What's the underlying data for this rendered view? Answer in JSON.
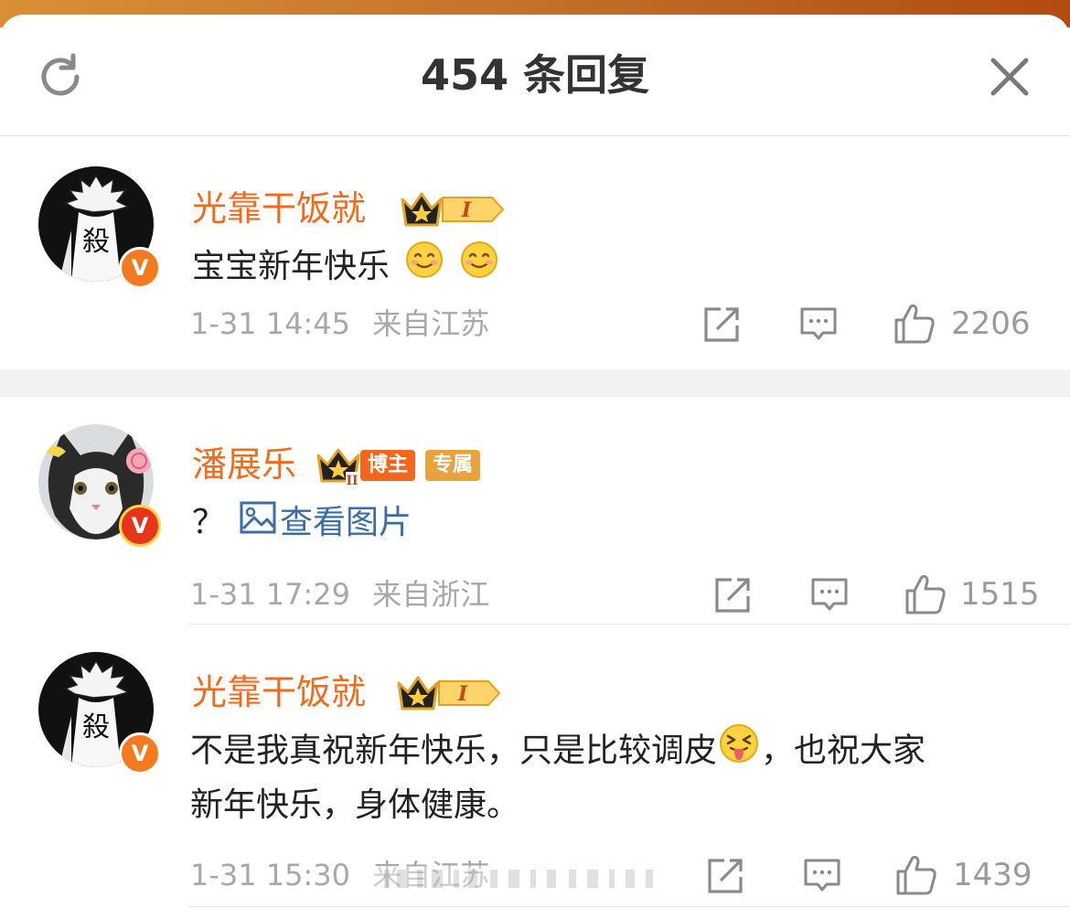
{
  "header": {
    "title": "454 条回复",
    "refresh_icon": "refresh-icon",
    "close_icon": "close-icon"
  },
  "colors": {
    "username": "#f26a1b",
    "link": "#3a6ea5",
    "meta": "#a8a8a8",
    "vbadge_orange": "#f47a20",
    "vbadge_red": "#e8341c"
  },
  "comments": [
    {
      "username": "光靠干饭就",
      "badge_level": "I",
      "text": "宝宝新年快乐",
      "emojis": [
        "smile-emoji",
        "smile-emoji"
      ],
      "time": "1-31 14:45",
      "location": "来自江苏",
      "likes": "2206"
    },
    {
      "username": "潘展乐",
      "badge_level": "II",
      "tags": [
        "博主",
        "专属"
      ],
      "text": "？",
      "image_link": "查看图片",
      "time": "1-31 17:29",
      "location": "来自浙江",
      "likes": "1515"
    },
    {
      "username": "光靠干饭就",
      "badge_level": "I",
      "text_line1_a": "不是我真祝新年快乐，只是比较调皮",
      "text_line1_b": "，也祝大家",
      "text_line2": "新年快乐，身体健康。",
      "emojis": [
        "tongue-out-emoji"
      ],
      "time": "1-31 15:30",
      "location": "来自江苏",
      "likes": "1439"
    }
  ]
}
